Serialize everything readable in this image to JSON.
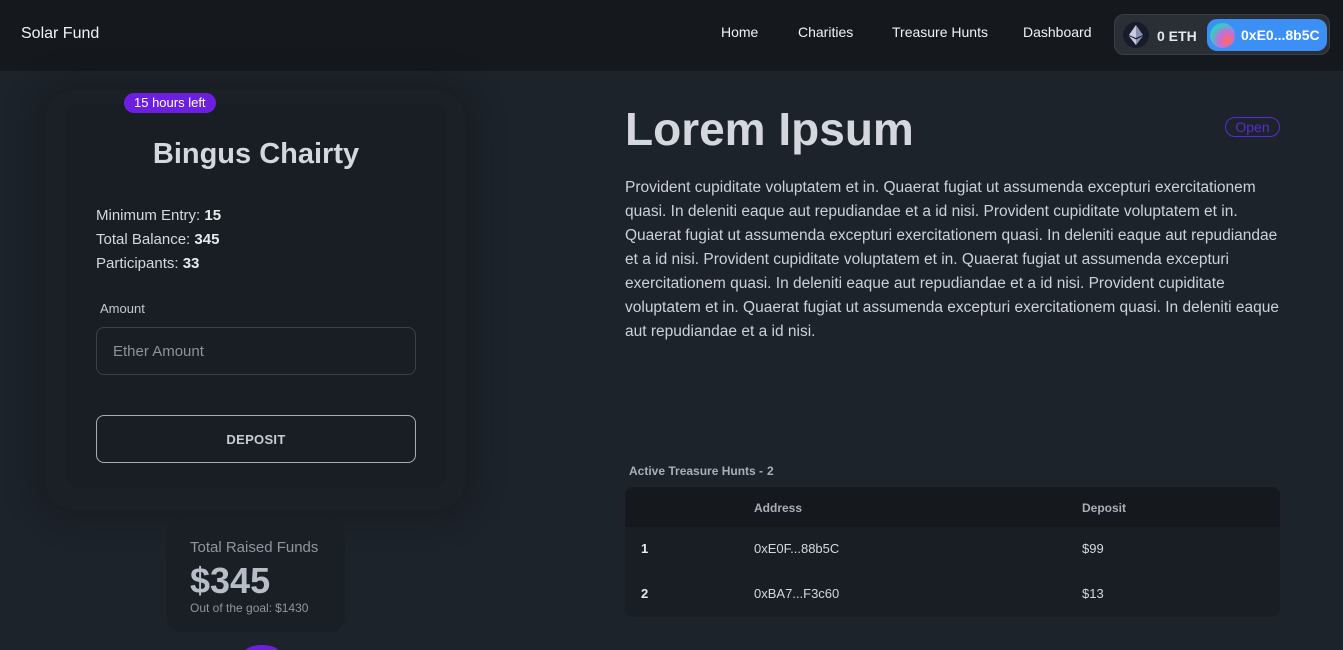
{
  "nav": {
    "brand": "Solar Fund",
    "links": [
      "Home",
      "Charities",
      "Treasure Hunts",
      "Dashboard"
    ],
    "wallet": {
      "balance": "0 ETH",
      "account": "0xE0...8b5C"
    }
  },
  "charity_card": {
    "time_left": "15 hours left",
    "title": "Bingus Chairty",
    "min_entry_label": "Minimum Entry:",
    "min_entry": "15",
    "balance_label": "Total Balance:",
    "balance": "345",
    "participants_label": "Participants:",
    "participants": "33",
    "amount_label": "Amount",
    "amount_placeholder": "Ether Amount",
    "deposit_label": "DEPOSIT"
  },
  "funds": {
    "label": "Total Raised Funds",
    "value": "$345",
    "goal_label": "Out of the goal:",
    "goal": "$1430"
  },
  "main": {
    "title": "Lorem Ipsum",
    "status": "Open",
    "description": "Provident cupiditate voluptatem et in. Quaerat fugiat ut assumenda excepturi exercitationem quasi. In deleniti eaque aut repudiandae et a id nisi. Provident cupiditate voluptatem et in. Quaerat fugiat ut assumenda excepturi exercitationem quasi. In deleniti eaque aut repudiandae et a id nisi. Provident cupiditate voluptatem et in. Quaerat fugiat ut assumenda excepturi exercitationem quasi. In deleniti eaque aut repudiandae et a id nisi. Provident cupiditate voluptatem et in. Quaerat fugiat ut assumenda excepturi exercitationem quasi. In deleniti eaque aut repudiandae et a id nisi."
  },
  "hunts": {
    "label": "Active Treasure Hunts -",
    "count": "2",
    "columns": [
      "",
      "Address",
      "Deposit"
    ],
    "rows": [
      {
        "index": "1",
        "address": "0xE0F...88b5C",
        "deposit": "$99"
      },
      {
        "index": "2",
        "address": "0xBA7...F3c60",
        "deposit": "$13"
      }
    ]
  },
  "colors": {
    "accent": "#6d1fe0",
    "account_button": "#3b8ff5",
    "background": "#1d232a",
    "navbar": "#15191e"
  },
  "icons": [
    "ethereum-icon",
    "avatar-icon"
  ]
}
